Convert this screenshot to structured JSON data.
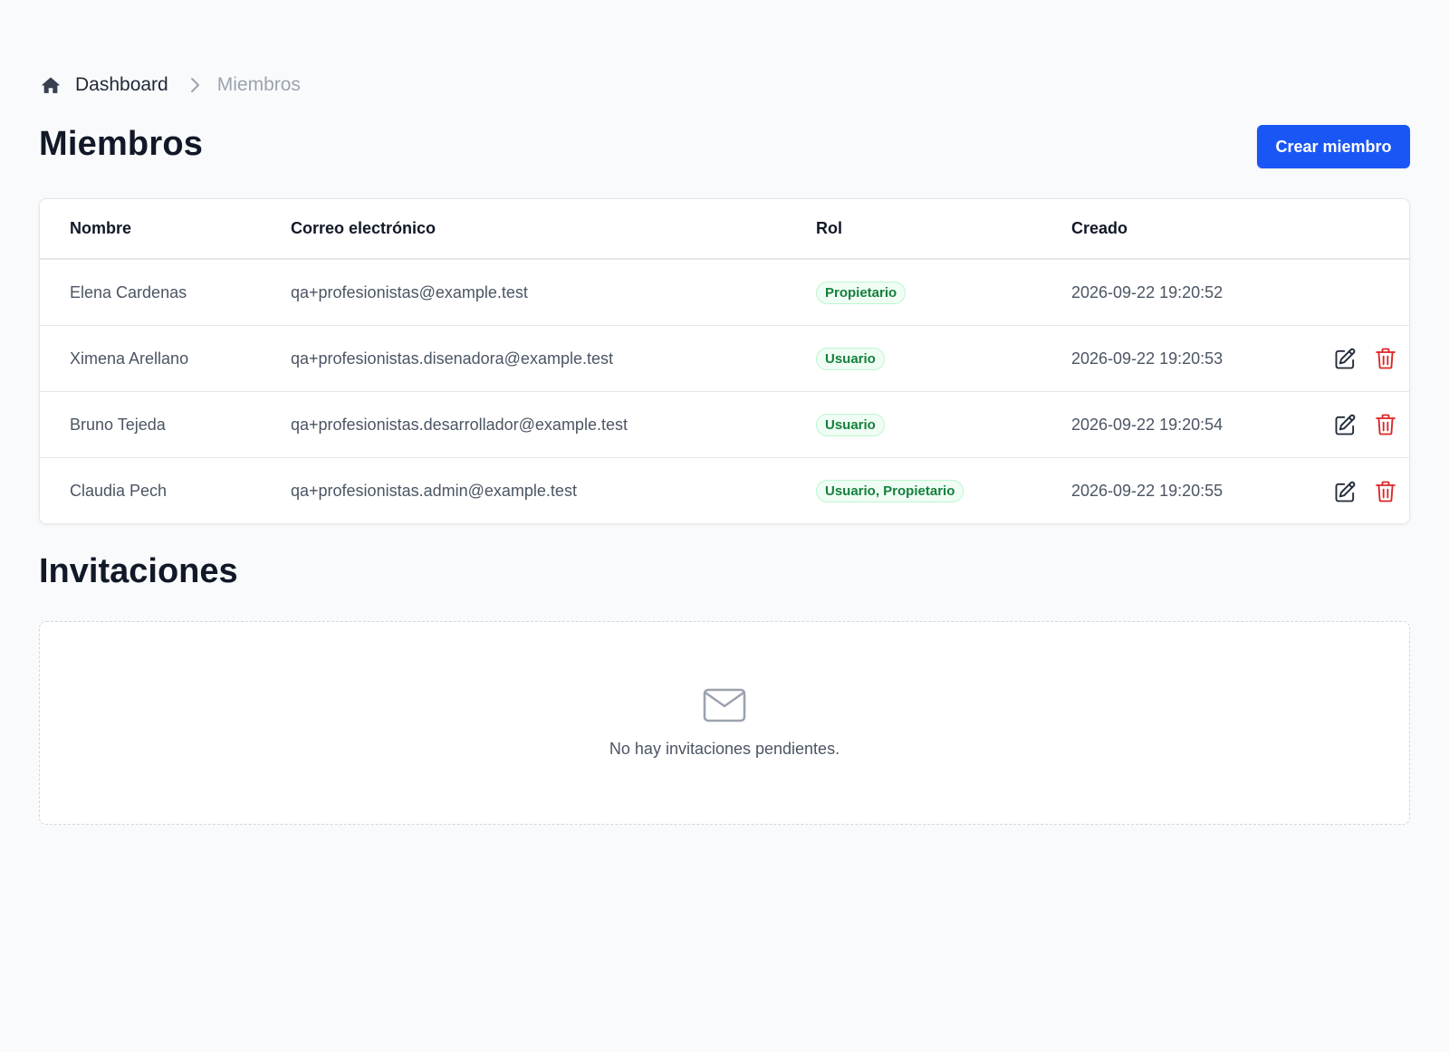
{
  "breadcrumb": {
    "home_icon": "home-icon",
    "dashboard_label": "Dashboard",
    "current_label": "Miembros"
  },
  "header": {
    "title": "Miembros",
    "create_button_label": "Crear miembro"
  },
  "members_table": {
    "columns": [
      "Nombre",
      "Correo electrónico",
      "Rol",
      "Creado"
    ],
    "rows": [
      {
        "name": "Elena Cardenas",
        "email": "qa+profesionistas@example.test",
        "role": "Propietario",
        "created": "2026-09-22 19:20:52",
        "actions": false
      },
      {
        "name": "Ximena Arellano",
        "email": "qa+profesionistas.disenadora@example.test",
        "role": "Usuario",
        "created": "2026-09-22 19:20:53",
        "actions": true
      },
      {
        "name": "Bruno Tejeda",
        "email": "qa+profesionistas.desarrollador@example.test",
        "role": "Usuario",
        "created": "2026-09-22 19:20:54",
        "actions": true
      },
      {
        "name": "Claudia Pech",
        "email": "qa+profesionistas.admin@example.test",
        "role": "Usuario, Propietario",
        "created": "2026-09-22 19:20:55",
        "actions": true
      }
    ]
  },
  "invitations": {
    "title": "Invitaciones",
    "empty_icon": "envelope-icon",
    "empty_message": "No hay invitaciones pendientes."
  },
  "colors": {
    "primary": "#1a56f5",
    "badge_text": "#15803d",
    "badge_bg": "#f0fdf4",
    "delete": "#dc2626",
    "page_bg": "#f9fafb"
  }
}
